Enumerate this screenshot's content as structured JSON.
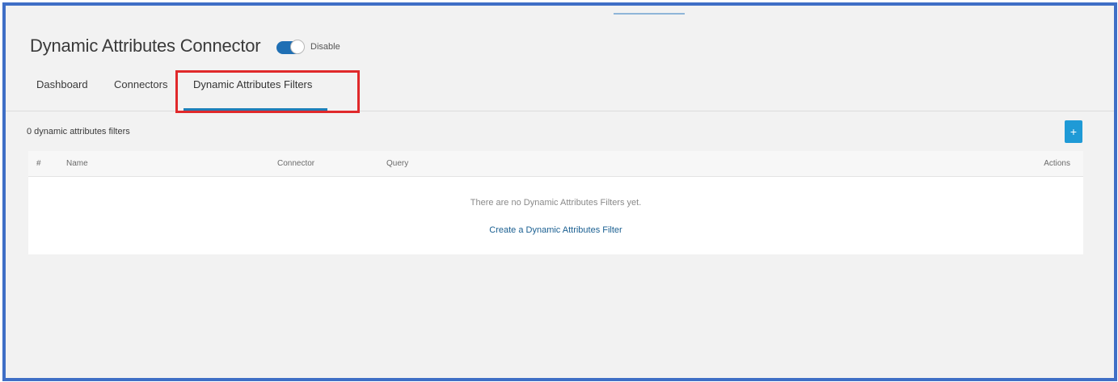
{
  "header": {
    "title": "Dynamic Attributes Connector",
    "toggle_label": "Disable"
  },
  "tabs": [
    {
      "label": "Dashboard"
    },
    {
      "label": "Connectors"
    },
    {
      "label": "Dynamic Attributes Filters",
      "active": true
    }
  ],
  "content": {
    "count_text": "0 dynamic attributes filters",
    "add_button_label": "+",
    "table": {
      "columns": [
        "#",
        "Name",
        "Connector",
        "Query",
        "Actions"
      ],
      "empty_message": "There are no Dynamic Attributes Filters yet.",
      "create_link": "Create a Dynamic Attributes Filter"
    }
  },
  "colors": {
    "accent": "#1f7fb8",
    "add_button": "#1f9ad6",
    "highlight": "#e0292b",
    "frame": "#3f6fc6"
  },
  "icons": {
    "toggle": "toggle-switch-on",
    "add": "plus-icon"
  }
}
